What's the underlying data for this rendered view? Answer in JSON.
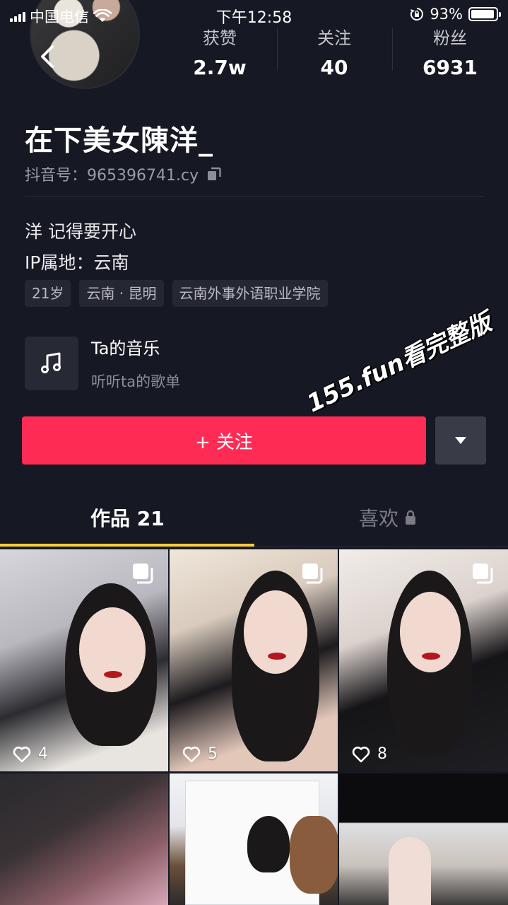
{
  "status_bar": {
    "carrier": "中国电信",
    "time": "下午12:58",
    "battery": "93%",
    "battery_level": 0.93
  },
  "stats": [
    {
      "label": "获赞",
      "value": "2.7w"
    },
    {
      "label": "关注",
      "value": "40"
    },
    {
      "label": "粉丝",
      "value": "6931"
    }
  ],
  "profile": {
    "name": "在下美女陳洋_",
    "douyin_id": "抖音号：965396741.cy",
    "bio": "洋 记得要开心",
    "ip": "IP属地：云南",
    "tags": [
      "21岁",
      "云南 · 昆明",
      "云南外事外语职业学院"
    ]
  },
  "music": {
    "title": "Ta的音乐",
    "subtitle": "听听ta的歌单"
  },
  "actions": {
    "follow_label": "+ 关注"
  },
  "watermark": "155.fun看完整版",
  "tabs": {
    "works": "作品 21",
    "likes": "喜欢"
  },
  "colors": {
    "background": "#161823",
    "follow": "#fe2c55",
    "tab_indicator": "#facd3c"
  },
  "videos": [
    {
      "likes": "4",
      "multi": true
    },
    {
      "likes": "5",
      "multi": true
    },
    {
      "likes": "8",
      "multi": true
    },
    {
      "likes": "",
      "multi": false
    },
    {
      "likes": "",
      "multi": false
    },
    {
      "likes": "",
      "multi": false
    }
  ]
}
